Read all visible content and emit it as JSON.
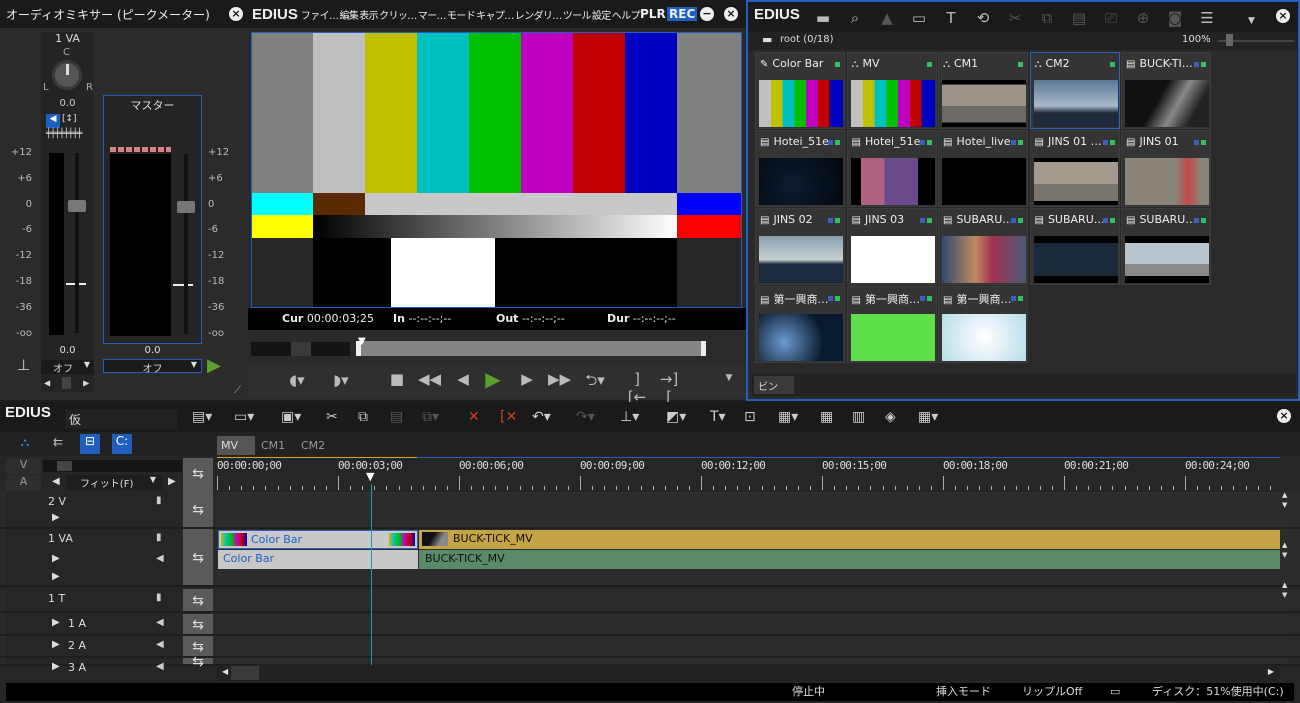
{
  "mixer": {
    "title": "オーディオミキサー (ピークメーター)",
    "channel": "1 VA",
    "pan_c": "C",
    "pan_l": "L",
    "pan_r": "R",
    "pan_value": "0.0",
    "master": "マスター",
    "scale": [
      "+12",
      "+6",
      "0",
      "-6",
      "-12",
      "-18",
      "-36",
      "-oo"
    ],
    "ch_gain": "0.0",
    "master_gain": "0.0",
    "ch_mode": "オフ",
    "master_mode": "オフ"
  },
  "player": {
    "logo": "EDIUS",
    "menu": [
      "ファイ…",
      "編集",
      "表示",
      "クリッ…",
      "マー…",
      "モード",
      "キャプ…",
      "レンダリ…",
      "ツール",
      "設定",
      "ヘルプ"
    ],
    "plr": "PLR",
    "rec": "REC",
    "cur_label": "Cur",
    "cur": "00:00:03;25",
    "in_label": "In",
    "in": "--:--:--;--",
    "out_label": "Out",
    "out": "--:--:--;--",
    "dur_label": "Dur",
    "dur": "--:--:--;--",
    "colorbars": {
      "top": [
        "#808080",
        "#c0c0c0",
        "#c0c000",
        "#00c0c0",
        "#00c000",
        "#c000c0",
        "#c00000",
        "#0000c0",
        "#808080"
      ],
      "mid": [
        "#00ffff",
        "#5a2a00",
        "#c8c8c8",
        "#0000ff"
      ],
      "low": [
        "#ffff00",
        "gradient",
        "#ff0000"
      ]
    },
    "play_color": "#5aa02c"
  },
  "bin": {
    "logo": "EDIUS",
    "path": "root (0/18)",
    "zoom": "100%",
    "tab": "ビン",
    "items": [
      {
        "name": "Color Bar",
        "icon": "eyedropper-icon",
        "thumb": "linear-gradient(90deg,#c0c0c0 0 14%,#c0c000 14% 28%,#00c0c0 28% 42%,#00c000 42% 56%,#c000c0 56% 70%,#c00000 70% 84%,#0000c0 84%)",
        "sel": false
      },
      {
        "name": "MV",
        "icon": "sequence-icon",
        "thumb": "linear-gradient(90deg,#c0c0c0 0 14%,#c0c000 14% 28%,#00c0c0 28% 42%,#00c000 42% 56%,#c000c0 56% 70%,#c00000 70% 84%,#0000c0 84%)",
        "sel": false
      },
      {
        "name": "CM1",
        "icon": "sequence-icon",
        "thumb": "linear-gradient(#000 0 10%,#9a948a 10% 55%,#6d6a66 55% 90%,#000 90%)",
        "sel": false
      },
      {
        "name": "CM2",
        "icon": "sequence-icon",
        "thumb": "linear-gradient(#5c7896,#a9b9c8 55%,#1e2a3a 70%)",
        "sel": true
      },
      {
        "name": "BUCK-TI…",
        "icon": "film-icon",
        "thumb": "linear-gradient(120deg,#111 40%,#888 60%,#222 80%)",
        "sel": false
      },
      {
        "name": "Hotei_51e…",
        "icon": "film-icon",
        "thumb": "radial-gradient(circle at 40% 60%,#0c1c30,#02060c)",
        "sel": false
      },
      {
        "name": "Hotei_51e…",
        "icon": "film-icon",
        "thumb": "linear-gradient(90deg,#000 12%,#b06080 12% 40%,#6a4a8a 40% 80%,#000 80%)",
        "sel": false
      },
      {
        "name": "Hotei_live…",
        "icon": "film-icon",
        "thumb": "#000",
        "sel": false
      },
      {
        "name": "JINS 01 …",
        "icon": "film-icon",
        "thumb": "linear-gradient(#000 0 8%,#a29a8c 8% 55%,#7a756c 55% 92%,#000 92%)",
        "sel": false
      },
      {
        "name": "JINS 01",
        "icon": "film-icon",
        "thumb": "linear-gradient(90deg,#8a8478 60%,#c04a4a 75%,#8a8478 90%)",
        "sel": false
      },
      {
        "name": "JINS 02",
        "icon": "film-icon",
        "thumb": "linear-gradient(#8aa0b0,#c8d0d0 50%,#1c2a40 60%)",
        "sel": false
      },
      {
        "name": "JINS 03",
        "icon": "film-icon",
        "thumb": "#ffffff",
        "sel": false
      },
      {
        "name": "SUBARU…",
        "icon": "film-icon",
        "thumb": "linear-gradient(90deg,#304a70,#c08a60 40%,#a03050 60%,#4a5a7a)",
        "sel": false
      },
      {
        "name": "SUBARU…",
        "icon": "film-icon",
        "thumb": "linear-gradient(#000 0 15%,#1a2a3a 15% 85%,#000 85%)",
        "sel": false
      },
      {
        "name": "SUBARU…",
        "icon": "film-icon",
        "thumb": "linear-gradient(#000 0 15%,#b8c4cc 15% 60%,#8a8a88 60% 85%,#000 85%)",
        "sel": false
      },
      {
        "name": "第一興商…",
        "icon": "film-icon",
        "thumb": "radial-gradient(circle at 30% 60%,#6a9ad0,#0a1a2e 60%)",
        "sel": false
      },
      {
        "name": "第一興商…",
        "icon": "film-icon",
        "thumb": "#5ee04a",
        "sel": false
      },
      {
        "name": "第一興商…",
        "icon": "film-icon",
        "thumb": "radial-gradient(circle,#ffffff,#b8dcea)",
        "sel": false
      }
    ],
    "toolbar": [
      "new-folder-icon",
      "search-icon",
      "up-icon",
      "open-folder-icon",
      "title-icon",
      "replace-icon",
      "cut-icon",
      "copy-icon",
      "paste-icon",
      "show-in-player-icon",
      "add-to-timeline-icon",
      "delete-icon",
      "list-view-icon"
    ]
  },
  "timeline": {
    "logo": "EDIUS",
    "project": "仮",
    "tabs": [
      "MV",
      "CM1",
      "CM2"
    ],
    "fit": "フィット(F)",
    "v_label": "V",
    "a_label": "A",
    "ruler": [
      "00:00:00;00",
      "00:00:03;00",
      "00:00:06;00",
      "00:00:09;00",
      "00:00:12;00",
      "00:00:15;00",
      "00:00:18;00",
      "00:00:21;00",
      "00:00:24;00"
    ],
    "tracks": [
      {
        "name": "2 V"
      },
      {
        "name": "1 VA"
      },
      {
        "name": "1 T"
      },
      {
        "name": "1 A"
      },
      {
        "name": "2 A"
      },
      {
        "name": "3 A"
      }
    ],
    "clips": {
      "colorbar_v": "Color Bar",
      "colorbar_a": "Color Bar",
      "buck_v": "BUCK-TICK_MV",
      "buck_a": "BUCK-TICK_MV",
      "video_color": "#c4a447",
      "audio_color": "#5a8a6a"
    },
    "status": {
      "state": "停止中",
      "mode": "挿入モード",
      "ripple": "リップルOff",
      "disk": "ディスク：51%使用中(C:)"
    }
  }
}
